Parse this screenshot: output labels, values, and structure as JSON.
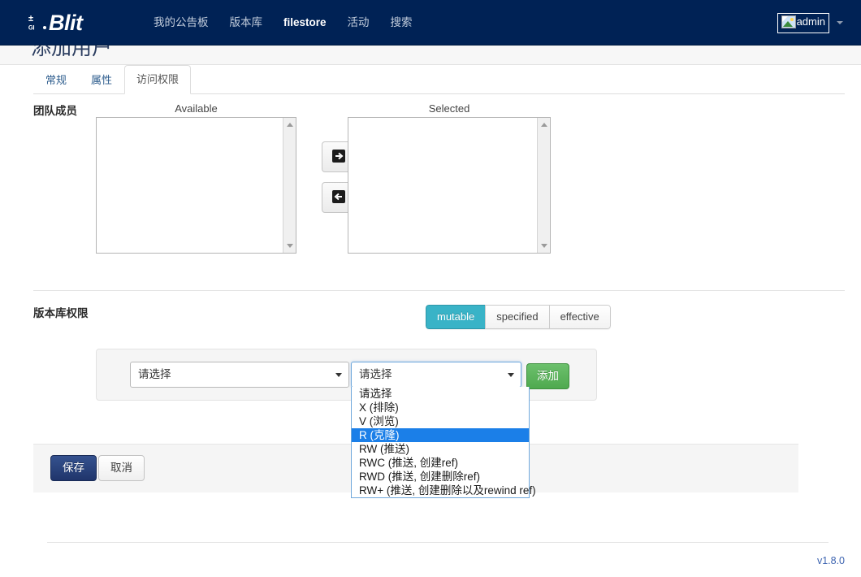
{
  "navbar": {
    "brand_text": "Blit",
    "brand_icon": "git-logo-icon",
    "links": [
      {
        "label": "我的公告板",
        "active": false
      },
      {
        "label": "版本库",
        "active": false
      },
      {
        "label": "filestore",
        "active": true
      },
      {
        "label": "活动",
        "active": false
      },
      {
        "label": "搜索",
        "active": false
      }
    ],
    "user": {
      "name": "admin",
      "avatar_icon": "broken-image-icon",
      "caret_icon": "caret-down-icon"
    }
  },
  "page": {
    "title": "添加用户"
  },
  "tabs": [
    {
      "label": "常规",
      "active": false
    },
    {
      "label": "属性",
      "active": false
    },
    {
      "label": "访问权限",
      "active": true
    }
  ],
  "team_members": {
    "label": "团队成员",
    "available_header": "Available",
    "selected_header": "Selected",
    "available_items": [],
    "selected_items": [],
    "move_right_icon": "arrow-right-into-box-icon",
    "move_left_icon": "arrow-left-into-box-icon"
  },
  "repo_permissions": {
    "label": "版本库权限",
    "view_modes": [
      {
        "label": "mutable",
        "active": true
      },
      {
        "label": "specified",
        "active": false
      },
      {
        "label": "effective",
        "active": false
      }
    ],
    "repo_select": {
      "value": "请选择",
      "caret_icon": "caret-down-icon"
    },
    "perm_select": {
      "value": "请选择",
      "caret_icon": "caret-down-icon",
      "focused": true,
      "open": true,
      "options": [
        {
          "label": "请选择",
          "selected": false
        },
        {
          "label": "X (排除)",
          "selected": false
        },
        {
          "label": "V (浏览)",
          "selected": false
        },
        {
          "label": "R (克隆)",
          "selected": true
        },
        {
          "label": "RW (推送)",
          "selected": false
        },
        {
          "label": "RWC (推送, 创建ref)",
          "selected": false
        },
        {
          "label": "RWD (推送, 创建删除ref)",
          "selected": false
        },
        {
          "label": "RW+ (推送, 创建删除以及rewind ref)",
          "selected": false
        }
      ]
    },
    "add_button": "添加"
  },
  "form_actions": {
    "save": "保存",
    "cancel": "取消"
  },
  "footer": {
    "version": "v1.8.0"
  },
  "colors": {
    "navbar_bg": "#002255",
    "accent_teal": "#39b3c7",
    "add_green": "#4fa94f",
    "save_blue": "#20356b",
    "highlight_blue": "#1b7fe8",
    "version_link": "#3c63b0"
  }
}
